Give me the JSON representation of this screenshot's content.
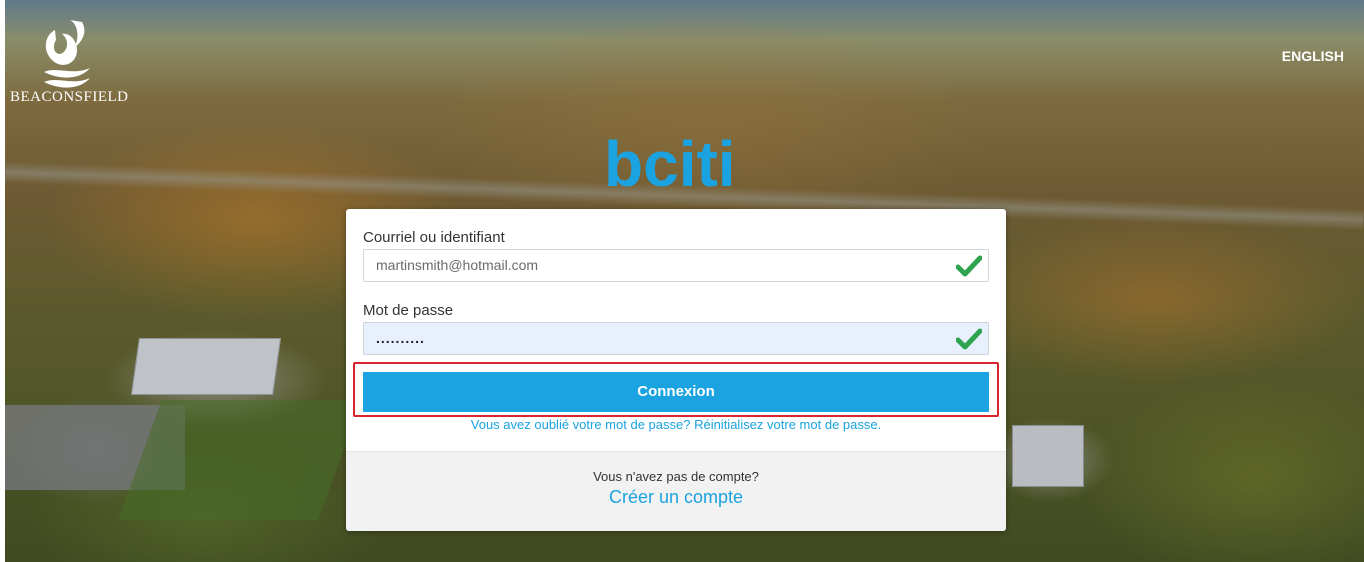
{
  "header": {
    "logo_text": "BEACONSFIELD",
    "language_link": "ENGLISH",
    "brand_name": "bciti"
  },
  "login_form": {
    "email_label": "Courriel ou identifiant",
    "email_value": "martinsmith@hotmail.com",
    "password_label": "Mot de passe",
    "password_value": "..........",
    "submit_label": "Connexion",
    "forgot_text": "Vous avez oublié votre mot de passe? Réinitialisez votre mot de passe.",
    "no_account_text": "Vous n'avez pas de compte?",
    "create_account_label": "Créer un compte"
  },
  "colors": {
    "accent": "#1aa3e0",
    "highlight_border": "#d9262e",
    "valid_check": "#2ea44f"
  },
  "icons": {
    "valid": "check-icon",
    "logo": "beaconsfield-logo-icon"
  }
}
